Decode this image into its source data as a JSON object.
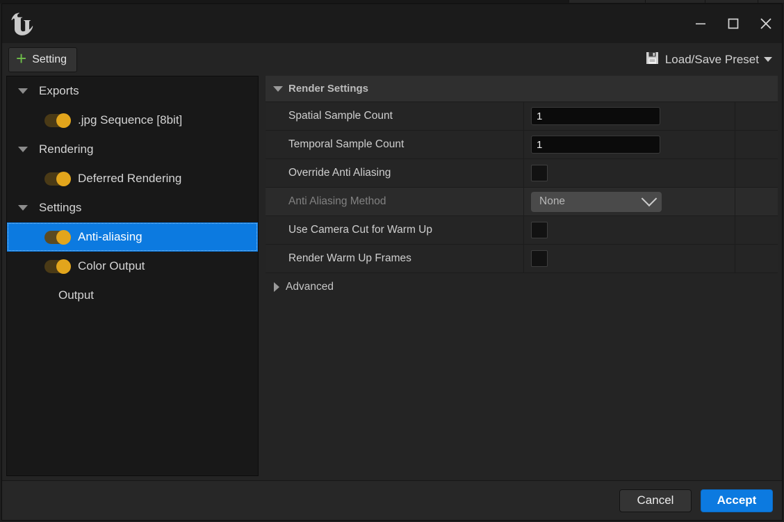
{
  "window": {
    "logo_glyph": "U",
    "controls": {
      "minimize": "minimize-icon",
      "maximize": "maximize-icon",
      "close": "close-icon"
    }
  },
  "toolbar": {
    "setting_label": "Setting",
    "setting_plus": "+",
    "preset_label": "Load/Save Preset"
  },
  "tree": {
    "items": [
      {
        "label": "Exports",
        "type": "group",
        "expanded": true,
        "toggle": null,
        "selected": false
      },
      {
        "label": ".jpg Sequence [8bit]",
        "type": "child",
        "expanded": false,
        "toggle": true,
        "selected": false
      },
      {
        "label": "Rendering",
        "type": "group",
        "expanded": true,
        "toggle": null,
        "selected": false
      },
      {
        "label": "Deferred Rendering",
        "type": "child",
        "expanded": false,
        "toggle": true,
        "selected": false
      },
      {
        "label": "Settings",
        "type": "group",
        "expanded": true,
        "toggle": null,
        "selected": false
      },
      {
        "label": "Anti-aliasing",
        "type": "child",
        "expanded": false,
        "toggle": true,
        "selected": true
      },
      {
        "label": "Color Output",
        "type": "child",
        "expanded": false,
        "toggle": true,
        "selected": false
      },
      {
        "label": "Output",
        "type": "child",
        "expanded": false,
        "toggle": null,
        "selected": false
      }
    ]
  },
  "details": {
    "category": "Render Settings",
    "rows": [
      {
        "name": "Spatial Sample Count",
        "widget": "number",
        "value": "1",
        "disabled": false
      },
      {
        "name": "Temporal Sample Count",
        "widget": "number",
        "value": "1",
        "disabled": false
      },
      {
        "name": "Override Anti Aliasing",
        "widget": "checkbox",
        "value": "",
        "disabled": false
      },
      {
        "name": "Anti Aliasing Method",
        "widget": "combo",
        "value": "None",
        "disabled": true
      },
      {
        "name": "Use Camera Cut for Warm Up",
        "widget": "checkbox",
        "value": "",
        "disabled": false
      },
      {
        "name": "Render Warm Up Frames",
        "widget": "checkbox",
        "value": "",
        "disabled": false
      }
    ],
    "advanced_label": "Advanced"
  },
  "footer": {
    "cancel_label": "Cancel",
    "accept_label": "Accept"
  },
  "colors": {
    "accent_blue": "#0c7ae0",
    "toggle_amber": "#e2a51c",
    "plus_green": "#6fbf4a",
    "window_bg": "#242424",
    "tree_bg": "#181818"
  }
}
